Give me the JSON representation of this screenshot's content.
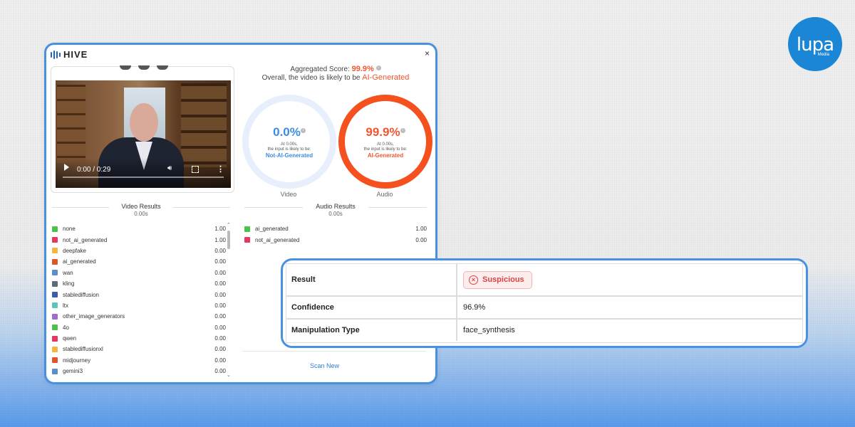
{
  "logo": {
    "word": "lupa",
    "sub": "Media"
  },
  "hive": {
    "brand": "HIVE",
    "close": "×"
  },
  "player": {
    "time": "0:00 / 0:29"
  },
  "aggregated": {
    "label": "Aggregated Score:",
    "score": "99.9%",
    "prefix": "Overall, the video is likely to be",
    "verdict": "AI-Generated"
  },
  "rings": {
    "video": {
      "pct": "0.0%",
      "at": "At 0.00s,",
      "likely": "the input is likely to be:",
      "label": "Not-AI-Generated",
      "caption": "Video"
    },
    "audio": {
      "pct": "99.9%",
      "at": "At 0.00s,",
      "likely": "the input is likely to be:",
      "label": "AI-Generated",
      "caption": "Audio"
    }
  },
  "video_results": {
    "title": "Video Results",
    "time": "0.00s",
    "rows": [
      {
        "label": "none",
        "value": "1.00",
        "color": "#4cc24c"
      },
      {
        "label": "not_ai_generated",
        "value": "1.00",
        "color": "#e8365d"
      },
      {
        "label": "deepfake",
        "value": "0.00",
        "color": "#f4b63a"
      },
      {
        "label": "ai_generated",
        "value": "0.00",
        "color": "#e0542a"
      },
      {
        "label": "wan",
        "value": "0.00",
        "color": "#5b8fc9"
      },
      {
        "label": "kling",
        "value": "0.00",
        "color": "#5f6b7a"
      },
      {
        "label": "stablediffusion",
        "value": "0.00",
        "color": "#3a5da8"
      },
      {
        "label": "ltx",
        "value": "0.00",
        "color": "#5bc4b6"
      },
      {
        "label": "other_image_generators",
        "value": "0.00",
        "color": "#a36bc9"
      },
      {
        "label": "4o",
        "value": "0.00",
        "color": "#4cc24c"
      },
      {
        "label": "qwen",
        "value": "0.00",
        "color": "#e8365d"
      },
      {
        "label": "stablediffusionxl",
        "value": "0.00",
        "color": "#f4b63a"
      },
      {
        "label": "midjourney",
        "value": "0.00",
        "color": "#e0542a"
      },
      {
        "label": "gemini3",
        "value": "0.00",
        "color": "#5b8fc9"
      }
    ]
  },
  "audio_results": {
    "title": "Audio Results",
    "time": "0.00s",
    "rows": [
      {
        "label": "ai_generated",
        "value": "1.00",
        "color": "#4cc24c"
      },
      {
        "label": "not_ai_generated",
        "value": "0.00",
        "color": "#e8365d"
      }
    ]
  },
  "scan_new": "Scan New",
  "result_card": {
    "result_key": "Result",
    "result_value": "Suspicious",
    "confidence_key": "Confidence",
    "confidence_value": "96.9%",
    "manipulation_key": "Manipulation Type",
    "manipulation_value": "face_synthesis"
  }
}
